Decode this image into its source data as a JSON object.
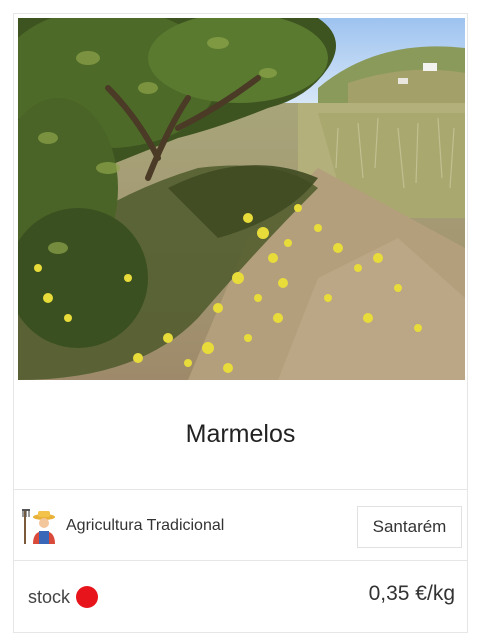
{
  "product": {
    "title": "Marmelos",
    "photo_icon": "orchard-photo",
    "producer_icon": "farmer-icon",
    "producer": "Agricultura Tradicional",
    "location": "Santarém",
    "stock_label": "stock",
    "stock_status_color": "#e8141c",
    "price": "0,35 €/kg"
  }
}
